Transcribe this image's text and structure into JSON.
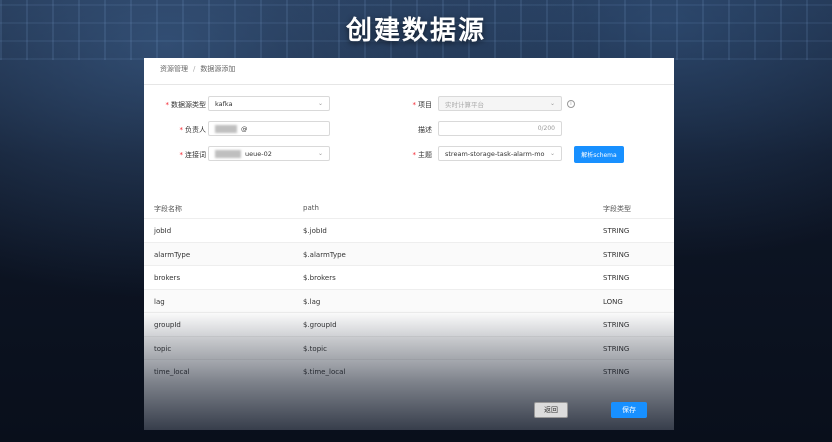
{
  "banner": {
    "title": "创建数据源"
  },
  "breadcrumb": {
    "items": [
      "资源管理",
      "数据源添加"
    ],
    "separator": "/"
  },
  "form": {
    "datasource_type": {
      "label": "数据源类型",
      "value": "kafka"
    },
    "project": {
      "label": "项目",
      "value": "实时计算平台"
    },
    "owner": {
      "label": "负责人",
      "value": "@"
    },
    "description": {
      "label": "描述",
      "counter": "0/200"
    },
    "connection": {
      "label": "连接词",
      "value": "ueue-02"
    },
    "topic": {
      "label": "主题",
      "value": "stream-storage-task-alarm-mo"
    },
    "parse_button": "解析schema"
  },
  "table": {
    "headers": [
      "字段名称",
      "path",
      "字段类型"
    ],
    "rows": [
      [
        "jobId",
        "$.jobId",
        "STRING"
      ],
      [
        "alarmType",
        "$.alarmType",
        "STRING"
      ],
      [
        "brokers",
        "$.brokers",
        "STRING"
      ],
      [
        "lag",
        "$.lag",
        "LONG"
      ],
      [
        "groupId",
        "$.groupId",
        "STRING"
      ],
      [
        "topic",
        "$.topic",
        "STRING"
      ],
      [
        "time_local",
        "$.time_local",
        "STRING"
      ]
    ]
  },
  "footer": {
    "back_label": "返回",
    "save_label": "保存"
  },
  "colors": {
    "primary": "#1890ff",
    "required": "#f5222d"
  },
  "icons": {
    "select_arrow": "chevron-down-icon",
    "info": "info-icon"
  }
}
